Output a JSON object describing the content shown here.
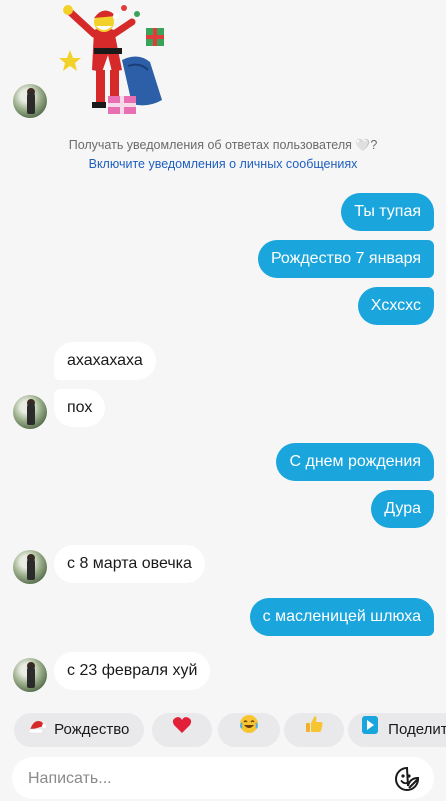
{
  "notice": {
    "line1_before": "Получать уведомления об ответах пользователя",
    "line1_after": "?",
    "line2": "Включите уведомления о личных сообщениях"
  },
  "messages": [
    {
      "dir": "out",
      "text": "Ты тупая"
    },
    {
      "dir": "out",
      "text": "Рождество 7 января"
    },
    {
      "dir": "out",
      "text": "Хсхсхс"
    },
    {
      "dir": "in",
      "text": "ахахахаха"
    },
    {
      "dir": "in",
      "text": "пох"
    },
    {
      "dir": "out",
      "text": "С днем рождения"
    },
    {
      "dir": "out",
      "text": "Дура"
    },
    {
      "dir": "in",
      "text": "с 8 марта овечка"
    },
    {
      "dir": "out",
      "text": "с масленицей шлюха"
    },
    {
      "dir": "in",
      "text": "с 23 февраля хуй"
    }
  ],
  "quick_replies": [
    {
      "icon": "santa-hat-icon",
      "label": "Рождество"
    },
    {
      "icon": "heart-icon",
      "label": ""
    },
    {
      "icon": "laughing-face-icon",
      "label": ""
    },
    {
      "icon": "thumbs-up-icon",
      "label": ""
    },
    {
      "icon": "share-play-icon",
      "label": "Поделит"
    }
  ],
  "composer": {
    "placeholder": "Написать...",
    "emoji_icon": "sticker-smile-icon"
  },
  "colors": {
    "outgoing_bubble": "#1aa5dc",
    "incoming_bubble": "#ffffff",
    "link": "#1f5fbf",
    "background": "#f6f6f7"
  }
}
